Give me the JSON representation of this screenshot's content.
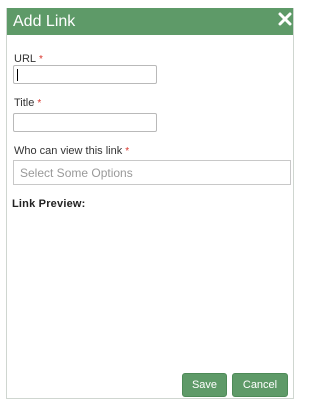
{
  "dialog": {
    "title": "Add Link",
    "close_icon": "close-icon"
  },
  "fields": {
    "url_label": "URL",
    "url_value": "",
    "title_label": "Title",
    "title_value": "",
    "viewers_label": "Who can view this link",
    "viewers_placeholder": "Select Some Options",
    "required_marker": "*"
  },
  "preview": {
    "label": "Link Preview:"
  },
  "buttons": {
    "save_label": "Save",
    "cancel_label": "Cancel"
  },
  "colors": {
    "accent": "#5e9a68",
    "required": "#d9342b"
  }
}
